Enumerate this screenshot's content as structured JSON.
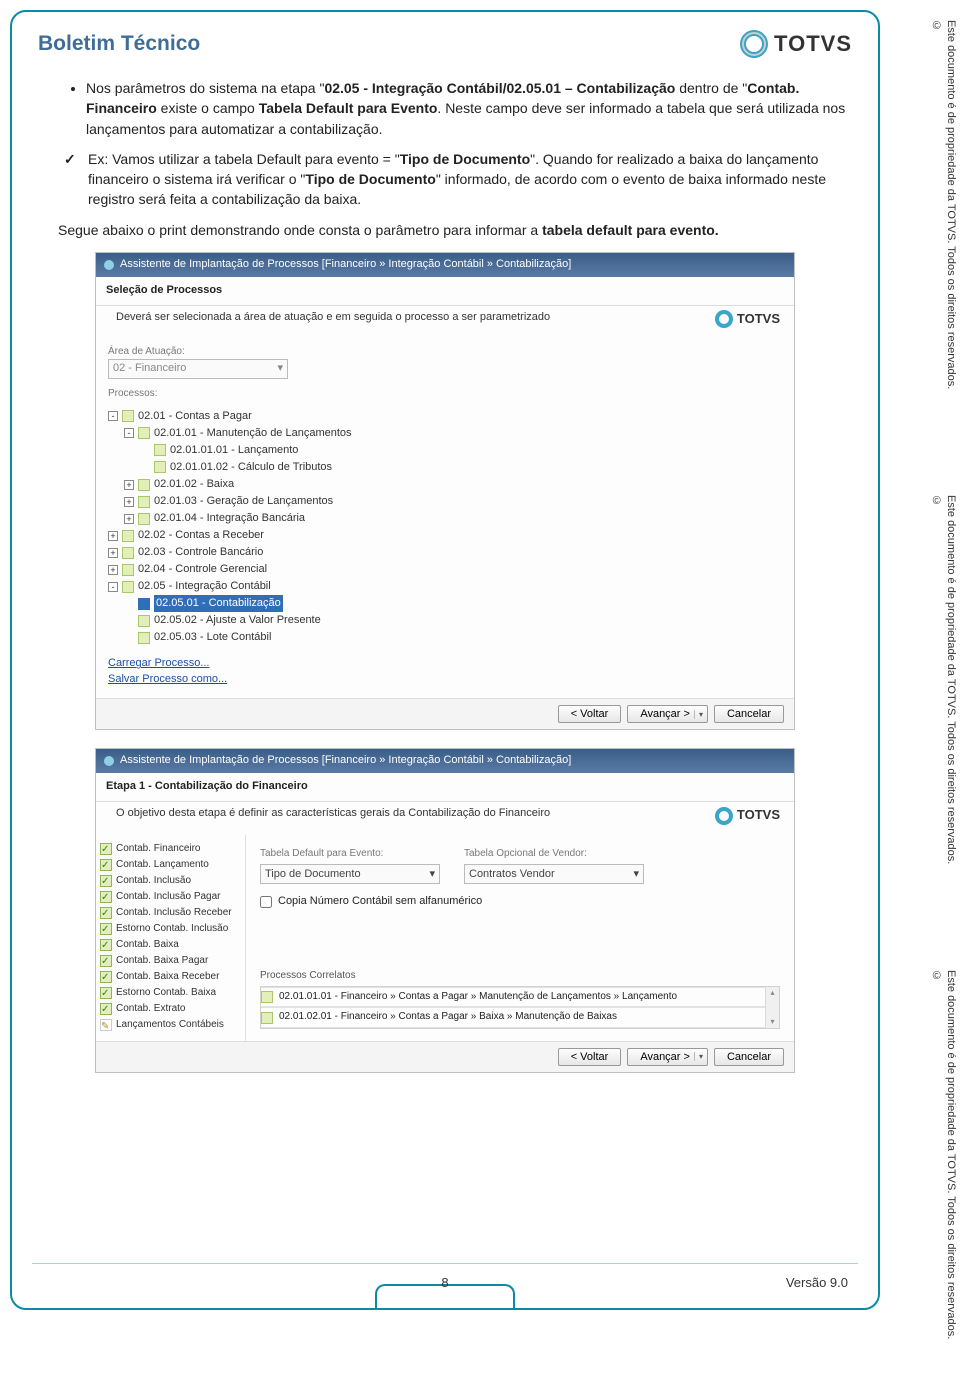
{
  "doc": {
    "title": "Boletim Técnico",
    "logo_text": "TOTVS"
  },
  "body": {
    "bullet1_pt1": "Nos parâmetros do sistema na etapa \"",
    "bullet1_bold": "02.05 - Integração Contábil/02.05.01 – Contabilização",
    "bullet1_pt2": " dentro de \"",
    "bullet1_bold2": "Contab. Financeiro",
    "bullet1_pt3": " existe o campo ",
    "bullet1_bold3": "Tabela Default para Evento",
    "bullet1_pt4": ". Neste campo deve ser informado a tabela que será utilizada nos lançamentos para automatizar a contabilização.",
    "check_pt1": "Ex: Vamos utilizar a tabela Default para evento = \"",
    "check_bold1": "Tipo de Documento",
    "check_pt2": "\". Quando for realizado a baixa do lançamento financeiro o sistema irá verificar o \"",
    "check_bold2": "Tipo de Documento",
    "check_pt3": "\" informado, de acordo com o evento de baixa informado neste registro será feita a contabilização da baixa.",
    "subline_pt1": "Segue abaixo o print demonstrando onde consta o parâmetro para informar a ",
    "subline_bold": "tabela default para evento."
  },
  "panel1": {
    "title": "Assistente de Implantação de Processos [Financeiro » Integração Contábil » Contabilização]",
    "section": "Seleção de Processos",
    "desc": "Deverá ser selecionada a área de atuação e em seguida o processo a ser parametrizado",
    "mini_logo": "TOTVS",
    "area_label": "Área de Atuação:",
    "area_value": "02 - Financeiro",
    "proc_label": "Processos:",
    "tree": [
      {
        "exp": "-",
        "lvl": 1,
        "text": "02.01 - Contas a Pagar"
      },
      {
        "exp": "-",
        "lvl": 2,
        "text": "02.01.01 - Manutenção de Lançamentos"
      },
      {
        "exp": "",
        "lvl": 3,
        "text": "02.01.01.01 - Lançamento"
      },
      {
        "exp": "",
        "lvl": 3,
        "text": "02.01.01.02 - Cálculo de Tributos"
      },
      {
        "exp": "+",
        "lvl": 2,
        "text": "02.01.02 - Baixa"
      },
      {
        "exp": "+",
        "lvl": 2,
        "text": "02.01.03 - Geração de Lançamentos"
      },
      {
        "exp": "+",
        "lvl": 2,
        "text": "02.01.04 - Integração Bancária"
      },
      {
        "exp": "+",
        "lvl": 1,
        "text": "02.02 - Contas a Receber"
      },
      {
        "exp": "+",
        "lvl": 1,
        "text": "02.03 - Controle Bancário"
      },
      {
        "exp": "+",
        "lvl": 1,
        "text": "02.04 - Controle Gerencial"
      },
      {
        "exp": "-",
        "lvl": 1,
        "text": "02.05 - Integração Contábil"
      },
      {
        "exp": "",
        "lvl": 2,
        "text": "02.05.01 - Contabilização",
        "selected": true
      },
      {
        "exp": "",
        "lvl": 2,
        "text": "02.05.02 - Ajuste a Valor Presente"
      },
      {
        "exp": "",
        "lvl": 2,
        "text": "02.05.03 - Lote Contábil"
      }
    ],
    "link1": "Carregar Processo...",
    "link2": "Salvar Processo como...",
    "btn_back": "< Voltar",
    "btn_next": "Avançar >",
    "btn_cancel": "Cancelar"
  },
  "panel2": {
    "title": "Assistente de Implantação de Processos [Financeiro » Integração Contábil » Contabilização]",
    "section": "Etapa 1 - Contabilização do Financeiro",
    "desc": "O objetivo desta etapa é definir as características gerais da Contabilização do Financeiro",
    "mini_logo": "TOTVS",
    "side_items": [
      {
        "label": "Contab. Financeiro",
        "state": "ok"
      },
      {
        "label": "Contab. Lançamento",
        "state": "ok"
      },
      {
        "label": "Contab. Inclusão",
        "state": "ok"
      },
      {
        "label": "Contab. Inclusão Pagar",
        "state": "ok"
      },
      {
        "label": "Contab. Inclusão Receber",
        "state": "ok"
      },
      {
        "label": "Estorno Contab. Inclusão",
        "state": "ok"
      },
      {
        "label": "Contab. Baixa",
        "state": "ok"
      },
      {
        "label": "Contab. Baixa Pagar",
        "state": "ok"
      },
      {
        "label": "Contab. Baixa Receber",
        "state": "ok"
      },
      {
        "label": "Estorno Contab. Baixa",
        "state": "ok"
      },
      {
        "label": "Contab. Extrato",
        "state": "ok"
      },
      {
        "label": "Lançamentos Contábeis",
        "state": "pen"
      }
    ],
    "field1_label": "Tabela Default para Evento:",
    "field1_value": "Tipo de Documento",
    "field2_label": "Tabela Opcional de Vendor:",
    "field2_value": "Contratos Vendor",
    "checkbox_label": "Copia Número Contábil sem alfanumérico",
    "proc_cor_label": "Processos Correlatos",
    "proc_cor_1": "02.01.01.01 - Financeiro » Contas a Pagar » Manutenção de Lançamentos » Lançamento",
    "proc_cor_2": "02.01.02.01 - Financeiro » Contas a Pagar » Baixa » Manutenção de Baixas",
    "btn_back": "< Voltar",
    "btn_next": "Avançar >",
    "btn_cancel": "Cancelar"
  },
  "sidebar_text": "Este documento é de propriedade da TOTVS. Todos os direitos reservados. ©",
  "footer": {
    "page": "8",
    "version": "Versão 9.0"
  }
}
